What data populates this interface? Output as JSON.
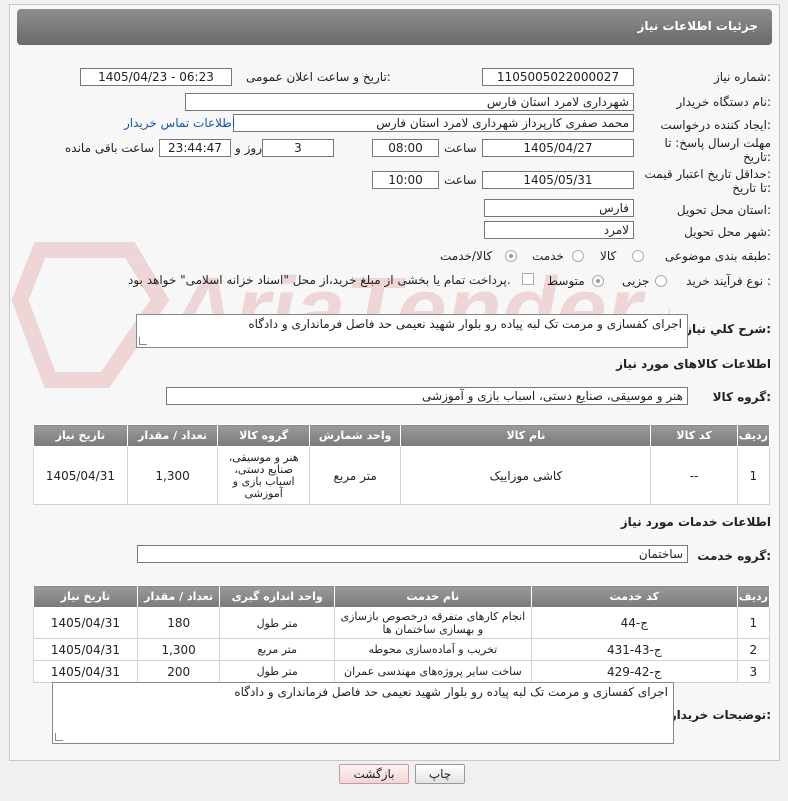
{
  "page_title": "جزئیات اطلاعات نیاز",
  "fields": {
    "need_number_label": "شماره نیاز:",
    "need_number": "1105005022000027",
    "announce_label": "تاریخ و ساعت اعلان عمومی:",
    "announce_value": "1405/04/23 - 06:23",
    "buyer_org_label": "نام دستگاه خریدار:",
    "buyer_org": "شهرداری لامرد استان فارس",
    "creator_label": "ایجاد کننده درخواست:",
    "creator": "محمد صفری کارپرداز شهرداری لامرد استان فارس",
    "contact_link": "اطلاعات تماس خریدار",
    "deadline_label_1": "مهلت ارسال پاسخ: تا",
    "deadline_label_2": "تاریخ:",
    "deadline_date": "1405/04/27",
    "time_label": "ساعت",
    "deadline_time": "08:00",
    "days_value": "3",
    "days_label": "روز و",
    "remaining_time": "23:44:47",
    "remaining_label": "ساعت باقی مانده",
    "validity_label_1": "حداقل تاریخ اعتبار قیمت:",
    "validity_label_2": "تا تاریخ:",
    "validity_date": "1405/05/31",
    "validity_time": "10:00",
    "province_label": "استان محل تحویل:",
    "province": "فارس",
    "city_label": "شهر محل تحویل:",
    "city": "لامرد",
    "category_label": "طبقه بندی موضوعی:",
    "category_options": [
      "کالا",
      "خدمت",
      "کالا/خدمت"
    ],
    "process_label": "نوع فرآیند خرید :",
    "process_options": [
      "جزیی",
      "متوسط"
    ],
    "payment_note": "پرداخت تمام یا بخشی از مبلغ خرید،از محل \"اسناد خزانه اسلامی\" خواهد بود."
  },
  "description_label": "شرح کلي نياز:",
  "description": "اجرای کفسازی و مرمت تک لبه پیاده رو بلوار شهید نعیمی حد فاصل فرمانداری و دادگاه",
  "goods_section_title": "اطلاعات کالاهای مورد نیاز",
  "goods_group_label": "گروه کالا:",
  "goods_group": "هنر و موسیقی، صنایع دستی، اسباب بازی و آموزشی",
  "goods_table": {
    "headers": [
      "ردیف",
      "کد کالا",
      "نام کالا",
      "واحد شمارش",
      "گروه کالا",
      "تعداد / مقدار",
      "تاریخ نیاز"
    ],
    "rows": [
      [
        "1",
        "--",
        "کاشی موزاییک",
        "متر مربع",
        "هنر و موسیقی، صنایع دستی، اسباب بازی و آموزشی",
        "1,300",
        "1405/04/31"
      ]
    ]
  },
  "services_section_title": "اطلاعات خدمات مورد نیاز",
  "service_group_label": "گروه خدمت:",
  "service_group": "ساختمان",
  "services_table": {
    "headers": [
      "ردیف",
      "کد خدمت",
      "نام خدمت",
      "واحد اندازه گیری",
      "تعداد / مقدار",
      "تاریخ نیاز"
    ],
    "rows": [
      [
        "1",
        "ج-44",
        "انجام کارهای متفرقه درخصوص بازسازی و بهسازی ساختمان ها",
        "متر طول",
        "180",
        "1405/04/31"
      ],
      [
        "2",
        "ج-43-431",
        "تخریب و آماده‌سازی محوطه",
        "متر مربع",
        "1,300",
        "1405/04/31"
      ],
      [
        "3",
        "ج-42-429",
        "ساخت سایر پروژه‌های مهندسی عمران",
        "متر طول",
        "200",
        "1405/04/31"
      ]
    ]
  },
  "buyer_notes_label": "توضیحات خریدار:",
  "buyer_notes": "اجرای کفسازی و مرمت تک لبه پیاده رو بلوار شهید نعیمی حد فاصل فرمانداری و دادگاه",
  "buttons": {
    "print": "چاپ",
    "back": "بازگشت"
  },
  "watermark_text": "AriaTender.neT"
}
